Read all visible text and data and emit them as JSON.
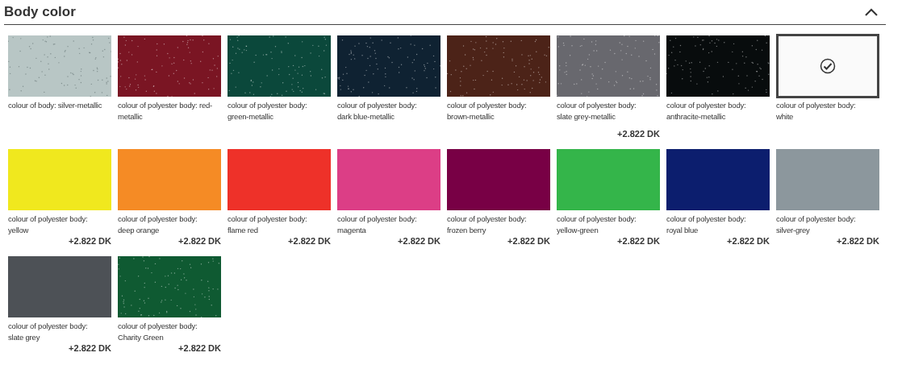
{
  "section": {
    "title": "Body color",
    "expanded": true
  },
  "swatches": [
    {
      "label": "colour of body: silver-metallic",
      "kind": "metallic",
      "color": "#b8c6c5",
      "selected": false
    },
    {
      "label": "colour of polyester body: red-metallic",
      "kind": "metallic",
      "color": "#7a1523",
      "selected": false
    },
    {
      "label": "colour of polyester body: green-metallic",
      "kind": "metallic",
      "color": "#0b483b",
      "selected": false
    },
    {
      "label": "colour of polyester body: dark blue-metallic",
      "kind": "metallic",
      "color": "#0f2232",
      "selected": false
    },
    {
      "label": "colour of polyester body: brown-metallic",
      "kind": "metallic",
      "color": "#4c2318",
      "selected": false
    },
    {
      "label": "colour of polyester body: slate grey-metallic",
      "kind": "metallic",
      "color": "#68686e",
      "selected": false,
      "price": "+2.822 DK"
    },
    {
      "label": "colour of polyester body: anthracite-metallic",
      "kind": "metallic",
      "color": "#080c0d",
      "selected": false
    },
    {
      "label": "colour of polyester body: white",
      "kind": "solid",
      "color": "#fafafa",
      "selected": true
    },
    {
      "label": "colour of polyester body: yellow",
      "kind": "solid",
      "color": "#f0e81e",
      "selected": false,
      "price": "+2.822 DK"
    },
    {
      "label": "colour of polyester body: deep orange",
      "kind": "solid",
      "color": "#f58b25",
      "selected": false,
      "price": "+2.822 DK"
    },
    {
      "label": "colour of polyester body: flame red",
      "kind": "solid",
      "color": "#ee3129",
      "selected": false,
      "price": "+2.822 DK"
    },
    {
      "label": "colour of polyester body: magenta",
      "kind": "solid",
      "color": "#dc3e86",
      "selected": false,
      "price": "+2.822 DK"
    },
    {
      "label": "colour of polyester body: frozen berry",
      "kind": "solid",
      "color": "#780045",
      "selected": false,
      "price": "+2.822 DK"
    },
    {
      "label": "colour of polyester body: yellow-green",
      "kind": "solid",
      "color": "#34b54a",
      "selected": false,
      "price": "+2.822 DK"
    },
    {
      "label": "colour of polyester body: royal blue",
      "kind": "solid",
      "color": "#0c1e6e",
      "selected": false,
      "price": "+2.822 DK"
    },
    {
      "label": "colour of polyester body: silver-grey",
      "kind": "solid",
      "color": "#8c979d",
      "selected": false,
      "price": "+2.822 DK"
    },
    {
      "label": "colour of polyester body: slate grey",
      "kind": "solid",
      "color": "#4d5156",
      "selected": false,
      "price": "+2.822 DK"
    },
    {
      "label": "colour of polyester body: Charity Green",
      "kind": "metallic",
      "color": "#0f5a32",
      "selected": false,
      "price": "+2.822 DK"
    }
  ]
}
